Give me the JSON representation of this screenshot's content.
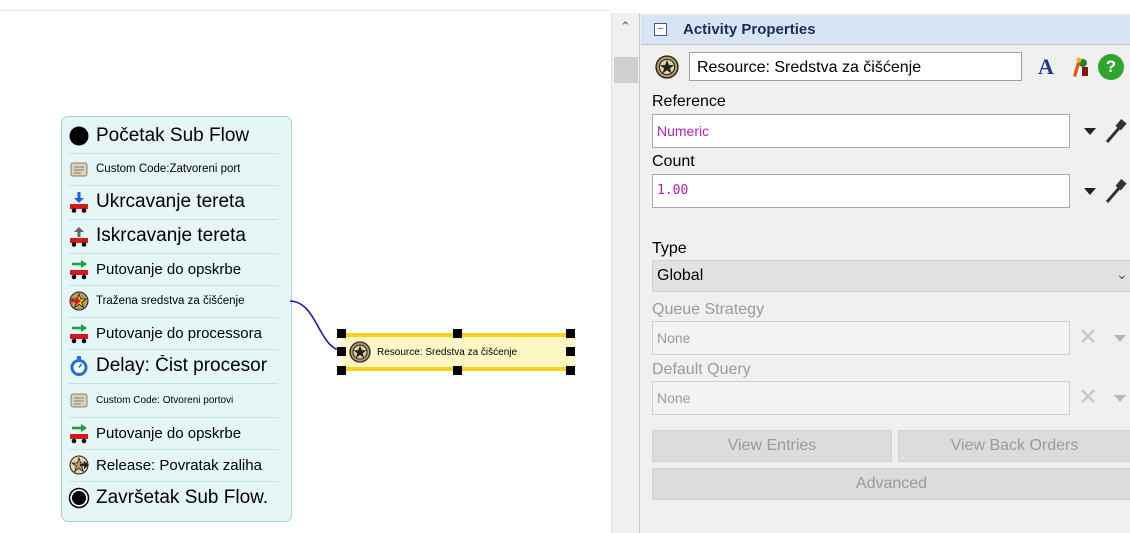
{
  "flow": {
    "activities": [
      {
        "icon": "start-circle-icon",
        "label": "Početak Sub Flow",
        "size": "big"
      },
      {
        "icon": "scroll-icon",
        "label": "Custom Code:Zatvoreni port",
        "size": "sm"
      },
      {
        "icon": "truck-load-icon",
        "label": "Ukrcavanje tereta",
        "size": "big"
      },
      {
        "icon": "truck-unload-icon",
        "label": "Iskrcavanje tereta",
        "size": "big"
      },
      {
        "icon": "travel-truck-icon",
        "label": "Putovanje do opskrbe",
        "size": "med"
      },
      {
        "icon": "acquire-resource-icon",
        "label": "Tražena sredstva za čišćenje",
        "size": "sm"
      },
      {
        "icon": "travel-truck-icon",
        "label": "Putovanje do processora",
        "size": "med"
      },
      {
        "icon": "stopwatch-icon",
        "label": "Delay: Čist procesor",
        "size": "big"
      },
      {
        "icon": "scroll-icon",
        "label": "Custom Code: Otvoreni portovi",
        "size": "tiny"
      },
      {
        "icon": "travel-truck-icon",
        "label": "Putovanje do opskrbe",
        "size": "med"
      },
      {
        "icon": "release-resource-icon",
        "label": "Release: Povratak zaliha",
        "size": "med"
      },
      {
        "icon": "finish-circle-icon",
        "label": "Završetak Sub Flow.",
        "size": "big"
      }
    ]
  },
  "shared_resource": {
    "label": "Resource: Sredstva za čišćenje",
    "icon": "resource-star-icon"
  },
  "scrollbar": {
    "up_icon": "chevron-up-icon"
  },
  "panel": {
    "title": "Activity Properties",
    "collapse_symbol": "−",
    "name_value": "Resource: Sredstva za čišćenje",
    "reference_label": "Reference",
    "reference_value": "Numeric",
    "count_label": "Count",
    "count_value": "1.00",
    "type_label": "Type",
    "type_value": "Global",
    "queue_strategy_label": "Queue Strategy",
    "queue_strategy_value": "None",
    "default_query_label": "Default Query",
    "default_query_value": "None",
    "view_entries_label": "View Entries",
    "view_back_orders_label": "View Back Orders",
    "advanced_label": "Advanced",
    "font_button_glyph": "A"
  },
  "colors": {
    "flow_bg": "#e6f6f7",
    "flow_border": "#a9d2d8",
    "resource_fill": "#fff8c4",
    "resource_border": "#f3d21a",
    "connector": "#1a1aa8",
    "header_bg": "#d6e4f3",
    "header_text": "#1e2d55",
    "value_magenta": "#b21db7"
  }
}
